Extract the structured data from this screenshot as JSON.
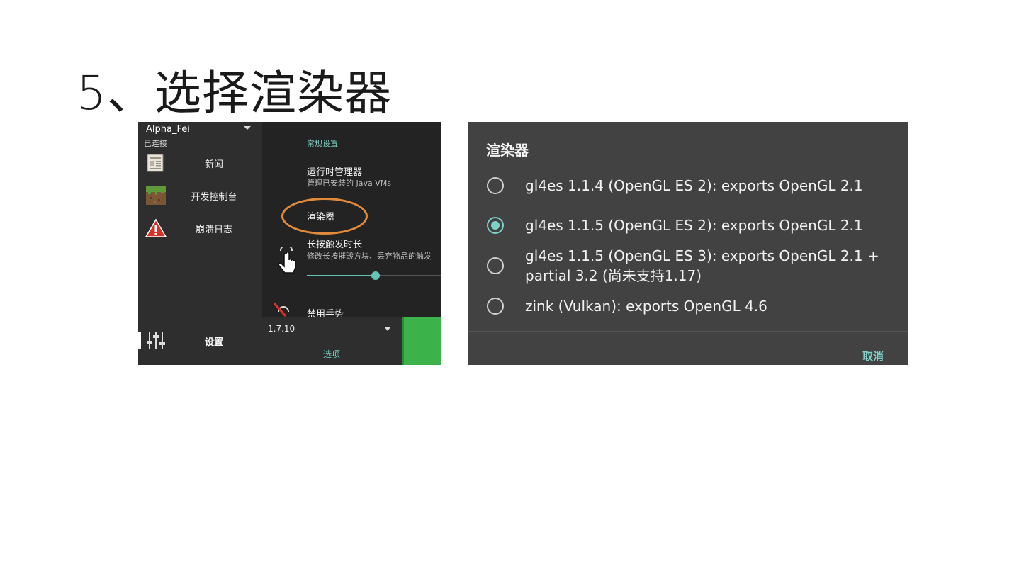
{
  "slide": {
    "title": "5、选择渲染器"
  },
  "left_screenshot": {
    "account": {
      "name": "Alpha_Fei",
      "status": "已连接"
    },
    "nav": [
      {
        "label": "新闻",
        "icon": "newspaper-icon"
      },
      {
        "label": "开发控制台",
        "icon": "grass-block-icon"
      },
      {
        "label": "崩溃日志",
        "icon": "warning-icon"
      }
    ],
    "settings_nav": {
      "label": "设置",
      "icon": "sliders-icon"
    },
    "settings": {
      "section_header": "常规设置",
      "runtime_title": "运行时管理器",
      "runtime_sub": "管理已安装的 Java VMs",
      "renderer_title": "渲染器",
      "longpress_title": "长按触发时长",
      "longpress_sub": "修改长按摧毁方块、丢弃物品的触发",
      "longpress_slider_fraction": 0.51,
      "gesture_title": "禁用手势"
    },
    "bottom": {
      "version": "1.7.10",
      "options": "选项"
    },
    "colors": {
      "accent": "#7fd1c7",
      "highlight_ring": "#e08a3a",
      "play_green": "#3bb34a"
    }
  },
  "dialog": {
    "title": "渲染器",
    "options": [
      {
        "label": "gl4es 1.1.4 (OpenGL ES 2): exports OpenGL 2.1",
        "checked": false
      },
      {
        "label": "gl4es 1.1.5 (OpenGL ES 2): exports OpenGL 2.1",
        "checked": true
      },
      {
        "label": "gl4es 1.1.5 (OpenGL ES 3): exports OpenGL 2.1 + partial 3.2 (尚未支持1.17)",
        "checked": false
      },
      {
        "label": "zink (Vulkan): exports OpenGL 4.6",
        "checked": false
      }
    ],
    "cancel": "取消"
  }
}
